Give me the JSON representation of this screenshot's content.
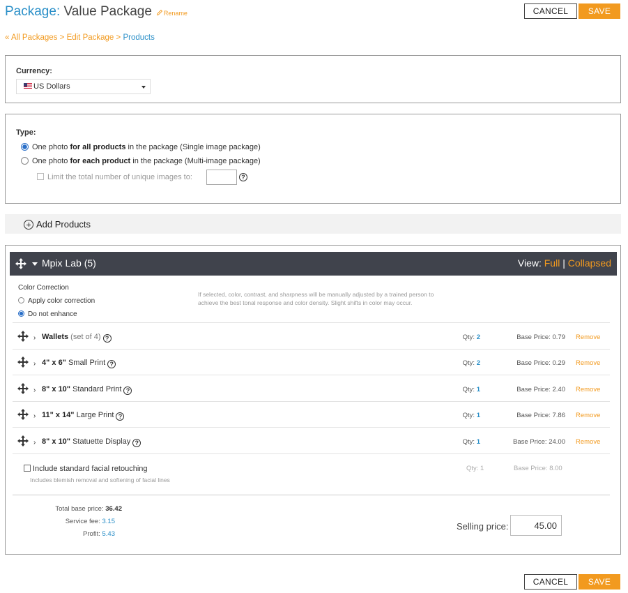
{
  "header": {
    "title_prefix": "Package:",
    "title_name": "Value Package",
    "rename_label": "Rename",
    "cancel_label": "CANCEL",
    "save_label": "SAVE"
  },
  "breadcrumb": {
    "items": [
      "« All Packages",
      "Edit Package",
      "Products"
    ],
    "separator": ">"
  },
  "currency": {
    "label": "Currency:",
    "selected": "US Dollars"
  },
  "type": {
    "label": "Type:",
    "options": [
      {
        "pre": "One photo ",
        "bold": "for all products",
        "post": " in the package (Single image package)",
        "selected": true
      },
      {
        "pre": "One photo ",
        "bold": "for each product",
        "post": " in the package (Multi-image package)",
        "selected": false
      }
    ],
    "limit_label": "Limit the total number of unique images to:",
    "limit_value": ""
  },
  "add_products_label": "Add Products",
  "lab": {
    "name": "Mpix Lab (5)",
    "view_label": "View:",
    "view_full": "Full",
    "view_sep": "|",
    "view_collapsed": "Collapsed",
    "color_correction": {
      "title": "Color Correction",
      "options": [
        {
          "label": "Apply color correction",
          "selected": false
        },
        {
          "label": "Do not enhance",
          "selected": true
        }
      ],
      "note": "If selected, color, contrast, and sharpness will be manually adjusted by a trained person to achieve the best tonal response and color density. Slight shifts in color may occur."
    },
    "products": [
      {
        "bold": "Wallets",
        "rest": " (set of 4)",
        "rest_muted": true,
        "qty_label": "Qty:",
        "qty": "2",
        "base_label": "Base Price:",
        "base": "0.79",
        "remove": "Remove"
      },
      {
        "bold": "4\" x 6\"",
        "rest": " Small Print",
        "rest_muted": false,
        "qty_label": "Qty:",
        "qty": "2",
        "base_label": "Base Price:",
        "base": "0.29",
        "remove": "Remove"
      },
      {
        "bold": "8\" x 10\"",
        "rest": " Standard Print",
        "rest_muted": false,
        "qty_label": "Qty:",
        "qty": "1",
        "base_label": "Base Price:",
        "base": "2.40",
        "remove": "Remove"
      },
      {
        "bold": "11\" x 14\"",
        "rest": " Large Print",
        "rest_muted": false,
        "qty_label": "Qty:",
        "qty": "1",
        "base_label": "Base Price:",
        "base": "7.86",
        "remove": "Remove"
      },
      {
        "bold": "8\" x 10\"",
        "rest": " Statuette Display",
        "rest_muted": false,
        "qty_label": "Qty:",
        "qty": "1",
        "base_label": "Base Price:",
        "base": "24.00",
        "remove": "Remove"
      }
    ],
    "retouch": {
      "label": "Include standard facial retouching",
      "sub": "Includes blemish removal and softening of facial lines",
      "qty_text": "Qty: 1",
      "base_text": "Base Price: 8.00"
    },
    "totals": {
      "base_label": "Total base price:",
      "base_value": "36.42",
      "fee_label": "Service fee:",
      "fee_value": "3.15",
      "profit_label": "Profit:",
      "profit_value": "5.43"
    },
    "selling_price_label": "Selling price:",
    "selling_price_value": "45.00"
  },
  "colors": {
    "accent_orange": "#f29a1f",
    "link_blue": "#2a8fc8",
    "lab_bar": "#40434c"
  }
}
